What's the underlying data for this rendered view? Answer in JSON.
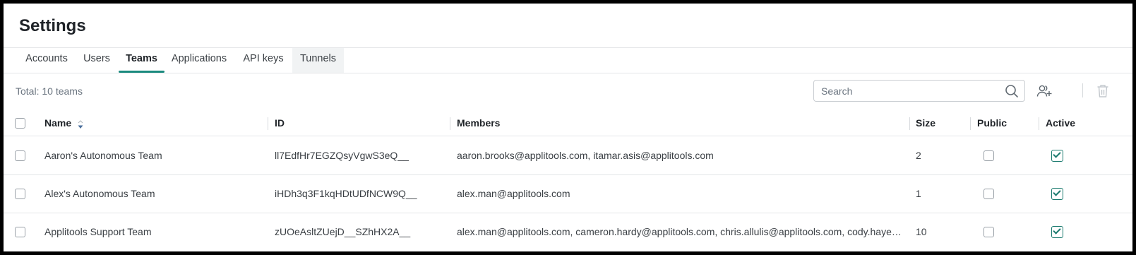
{
  "page_title": "Settings",
  "tabs": [
    {
      "label": "Accounts"
    },
    {
      "label": "Users"
    },
    {
      "label": "Teams",
      "active": true
    },
    {
      "label": "Applications"
    },
    {
      "label": "API keys"
    },
    {
      "label": "Tunnels"
    }
  ],
  "toolbar": {
    "total_text": "Total: 10 teams",
    "search_placeholder": "Search",
    "search_icon": "search-icon",
    "add_team_icon": "add-users-icon",
    "delete_icon": "trash-icon"
  },
  "table": {
    "headers": {
      "name": "Name",
      "id": "ID",
      "members": "Members",
      "size": "Size",
      "public": "Public",
      "active": "Active"
    },
    "sort_icon": "sort-descending-icon",
    "rows": [
      {
        "name": "Aaron's Autonomous Team",
        "id": "ll7EdfHr7EGZQsyVgwS3eQ__",
        "members": "aaron.brooks@applitools.com, itamar.asis@applitools.com",
        "size": "2",
        "public": false,
        "active": true
      },
      {
        "name": "Alex's Autonomous Team",
        "id": "iHDh3q3F1kqHDtUDfNCW9Q__",
        "members": "alex.man@applitools.com",
        "size": "1",
        "public": false,
        "active": true
      },
      {
        "name": "Applitools Support Team",
        "id": "zUOeAsltZUejD__SZhHX2A__",
        "members": "alex.man@applitools.com, cameron.hardy@applitools.com, chris.allulis@applitools.com, cody.hayes@applitools.com",
        "size": "10",
        "public": false,
        "active": true
      }
    ]
  },
  "colors": {
    "accent": "#1a8a7e",
    "border": "#e4e6e8",
    "muted_text": "#6b7580"
  }
}
